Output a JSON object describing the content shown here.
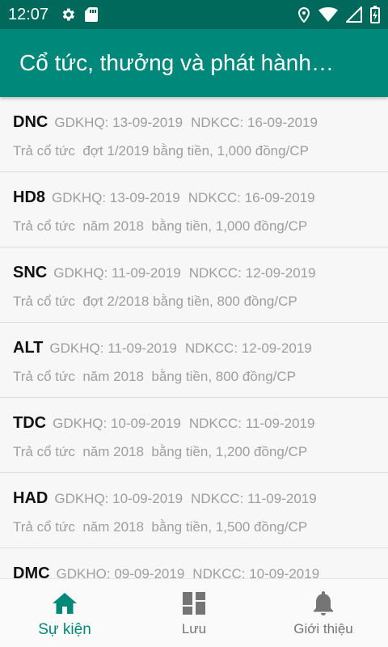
{
  "status_bar": {
    "time": "12:07",
    "left_icons": [
      "gear-icon",
      "sd-card-icon"
    ],
    "right_icons": [
      "location-icon",
      "wifi-icon",
      "signal-icon",
      "battery-charging-icon"
    ]
  },
  "app_bar": {
    "title": "Cổ tức, thưởng và phát hành…",
    "color": "#00897b",
    "status_color": "#00695c"
  },
  "events": [
    {
      "ticker": "DNC",
      "gdkhq": "GDKHQ: 13-09-2019",
      "ndkcc": "NDKCC: 16-09-2019",
      "description": "Trả cổ tức  đợt 1/2019 bằng tiền, 1,000 đồng/CP"
    },
    {
      "ticker": "HD8",
      "gdkhq": "GDKHQ: 13-09-2019",
      "ndkcc": "NDKCC: 16-09-2019",
      "description": "Trả cổ tức  năm 2018  bằng tiền, 1,000 đồng/CP"
    },
    {
      "ticker": "SNC",
      "gdkhq": "GDKHQ: 11-09-2019",
      "ndkcc": "NDKCC: 12-09-2019",
      "description": "Trả cổ tức  đợt 2/2018 bằng tiền, 800 đồng/CP"
    },
    {
      "ticker": "ALT",
      "gdkhq": "GDKHQ: 11-09-2019",
      "ndkcc": "NDKCC: 12-09-2019",
      "description": "Trả cổ tức  năm 2018  bằng tiền, 800 đồng/CP"
    },
    {
      "ticker": "TDC",
      "gdkhq": "GDKHQ: 10-09-2019",
      "ndkcc": "NDKCC: 11-09-2019",
      "description": "Trả cổ tức  năm 2018  bằng tiền, 1,200 đồng/CP"
    },
    {
      "ticker": "HAD",
      "gdkhq": "GDKHQ: 10-09-2019",
      "ndkcc": "NDKCC: 11-09-2019",
      "description": "Trả cổ tức  năm 2018  bằng tiền, 1,500 đồng/CP"
    },
    {
      "ticker": "DMC",
      "gdkhq": "GDKHQ: 09-09-2019",
      "ndkcc": "NDKCC: 10-09-2019",
      "description": ""
    }
  ],
  "bottom_nav": {
    "items": [
      {
        "label": "Sự kiện",
        "icon": "home-icon",
        "active": true
      },
      {
        "label": "Lưu",
        "icon": "dashboard-icon",
        "active": false
      },
      {
        "label": "Giới thiệu",
        "icon": "bell-icon",
        "active": false
      }
    ],
    "active_color": "#00897b",
    "inactive_color": "#757575"
  }
}
